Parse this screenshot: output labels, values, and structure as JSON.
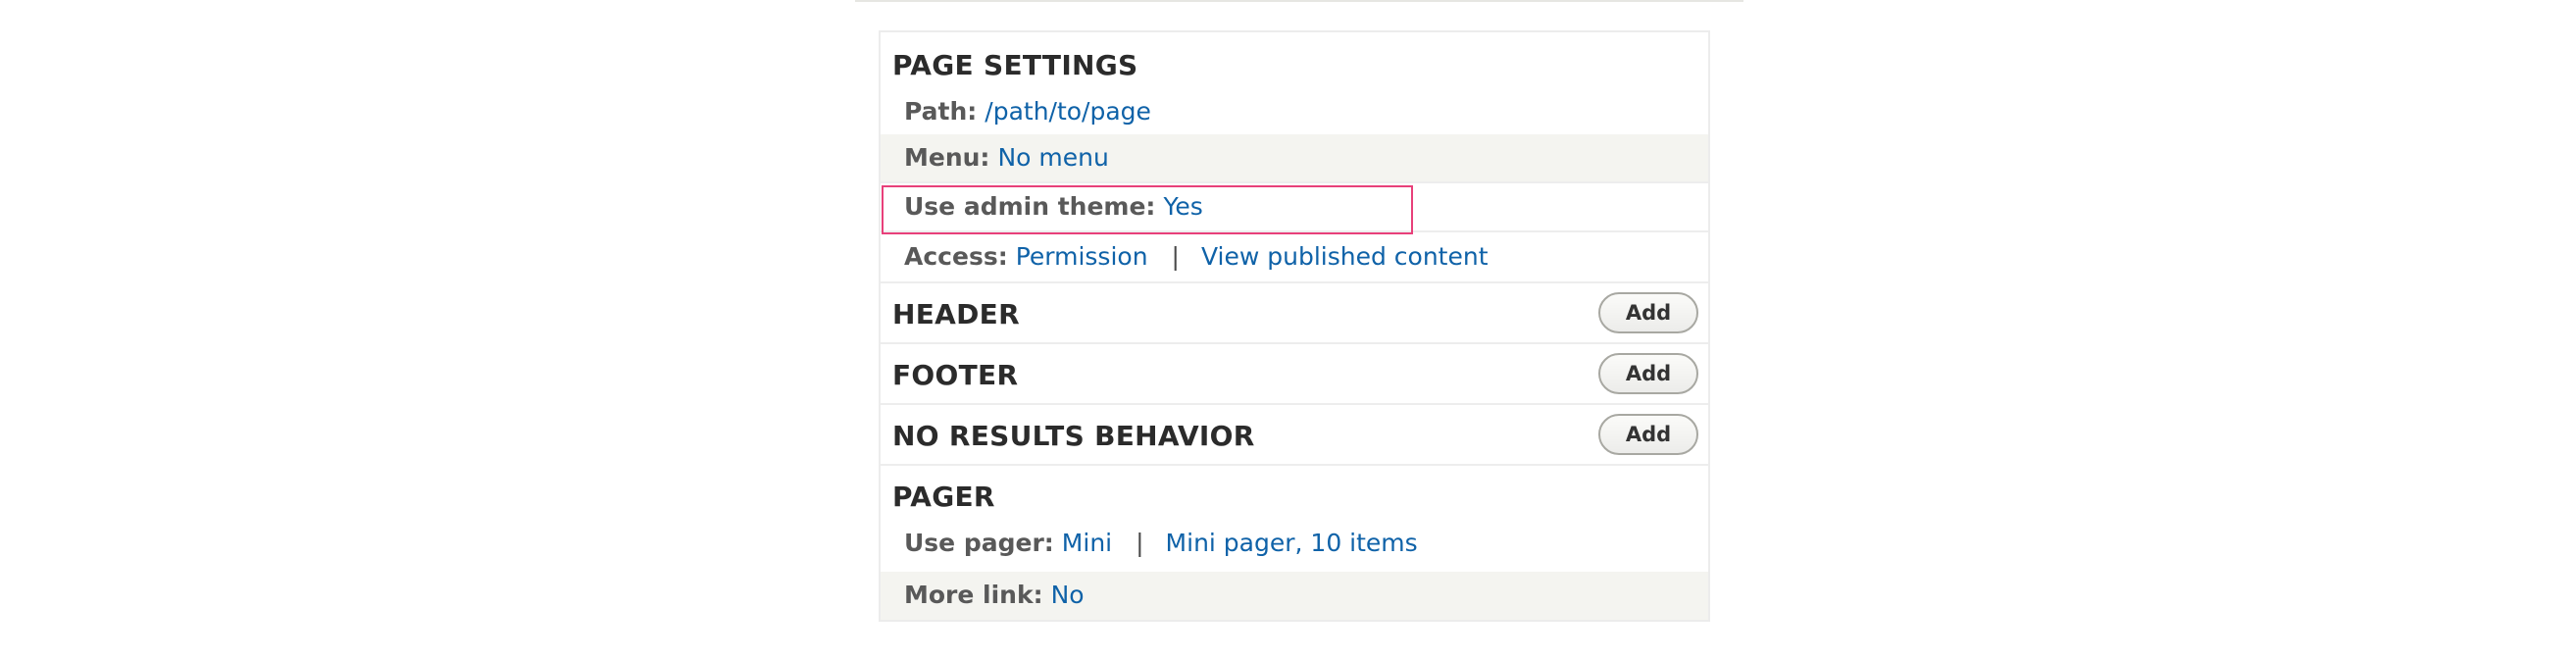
{
  "page_settings": {
    "title": "PAGE SETTINGS",
    "path": {
      "label": "Path:",
      "value": "/path/to/page"
    },
    "menu": {
      "label": "Menu:",
      "value": "No menu"
    },
    "admin_theme": {
      "label": "Use admin theme:",
      "value": "Yes"
    },
    "access": {
      "label": "Access:",
      "value": "Permission",
      "separator": "|",
      "value2": "View published content"
    }
  },
  "header": {
    "title": "HEADER",
    "add_label": "Add"
  },
  "footer": {
    "title": "FOOTER",
    "add_label": "Add"
  },
  "no_results": {
    "title": "NO RESULTS BEHAVIOR",
    "add_label": "Add"
  },
  "pager": {
    "title": "PAGER",
    "use_pager": {
      "label": "Use pager:",
      "value": "Mini",
      "separator": "|",
      "value2": "Mini pager, 10 items"
    },
    "more_link": {
      "label": "More link:",
      "value": "No"
    }
  },
  "colors": {
    "link": "#0f62a8",
    "highlight": "#e8407a",
    "shaded_row": "#f4f4f0"
  }
}
